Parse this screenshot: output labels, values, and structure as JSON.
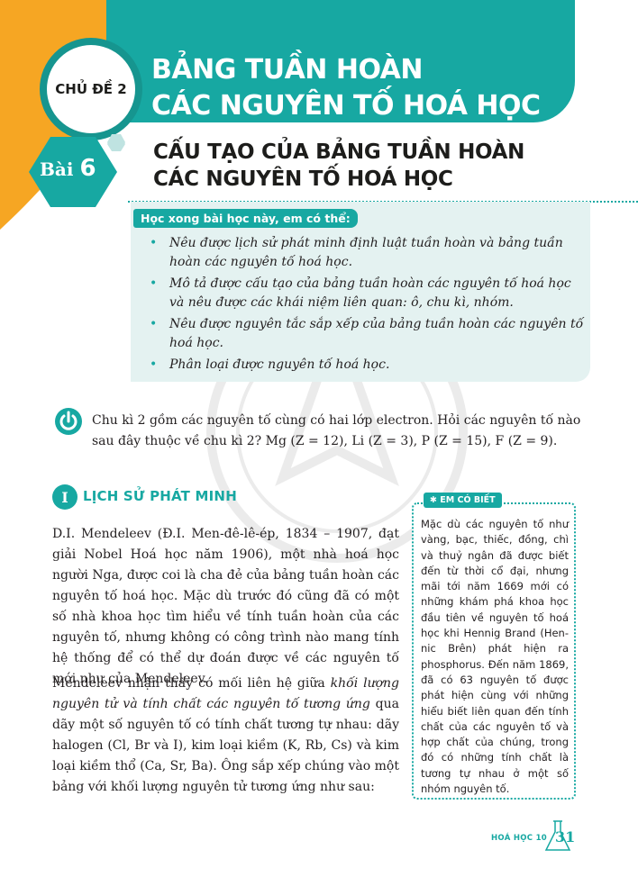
{
  "header": {
    "chapter_label": "CHỦ ĐỀ 2",
    "chapter_title_line1": "BẢNG TUẦN HOÀN",
    "chapter_title_line2": "CÁC NGUYÊN TỐ HOÁ HỌC",
    "lesson_word": "Bài",
    "lesson_number": "6",
    "lesson_title_line1": "CẤU TẠO CỦA BẢNG TUẦN HOÀN",
    "lesson_title_line2": "CÁC NGUYÊN TỐ HOÁ HỌC"
  },
  "objectives": {
    "heading": "Học xong bài học này, em có thể:",
    "items": [
      "Nêu được lịch sử phát minh định luật tuần hoàn và bảng tuần hoàn các nguyên tố hoá học.",
      "Mô tả được cấu tạo của bảng tuần hoàn các nguyên tố hoá học và nêu được các khái niệm liên quan: ô, chu kì, nhóm.",
      "Nêu được nguyên tắc sắp xếp của bảng tuần hoàn các nguyên tố hoá học.",
      "Phân loại được nguyên tố hoá học."
    ]
  },
  "question": {
    "text": "Chu kì 2 gồm các nguyên tố cùng có hai lớp electron. Hỏi các nguyên tố nào sau đây thuộc về chu kì 2? Mg (Z = 12), Li (Z = 3), P (Z = 15), F (Z = 9)."
  },
  "section": {
    "number": "I",
    "title": "LỊCH SỬ PHÁT MINH",
    "paragraph1": "D.I. Mendeleev (Đ.I. Men-đê-lê-ép, 1834 – 1907, đạt giải Nobel Hoá học năm 1906), một nhà hoá học người Nga, được coi là cha đẻ của bảng tuần hoàn các nguyên tố hoá học. Mặc dù trước đó cũng đã có một số nhà khoa học tìm hiểu về tính tuần hoàn của các nguyên tố, nhưng không có công trình nào mang tính hệ thống để có thể dự đoán được về các nguyên tố mới như của Mendeleev.",
    "paragraph2_start": "Mendeleev nhận thấy có mối liên hệ giữa ",
    "paragraph2_emphasis": "khối lượng nguyên tử và tính chất các nguyên tố tương ứng",
    "paragraph2_end": " qua dãy một số nguyên tố có tính chất tương tự nhau: dãy halogen (Cl, Br và I), kim loại kiềm (K, Rb, Cs) và kim loại kiềm thổ (Ca, Sr, Ba). Ông sắp xếp chúng vào một bảng với khối lượng nguyên tử tương ứng như sau:"
  },
  "sidebox": {
    "heading": "EM CÓ BIẾT",
    "text": "Mặc dù các nguyên tố như vàng, bạc, thiếc, đồng, chì và thuỷ ngân đã được biết đến từ thời cổ đại, nhưng mãi tới năm 1669 mới có những khám phá khoa học đầu tiên về nguyên tố hoá học khi Hennig Brand (Hen-nic Brên) phát hiện ra phosphorus. Đến năm 1869, đã có 63 nguyên tố được phát hiện cùng với những hiểu biết liên quan đến tính chất của các nguyên tố và hợp chất của chúng, trong đó có những tính chất là tương tự nhau ở một số nhóm nguyên tố."
  },
  "footer": {
    "book": "HOÁ HỌC 10",
    "page": "31"
  },
  "colors": {
    "teal": "#17a8a2",
    "orange": "#f6a623",
    "light_teal_bg": "#e4f2f1"
  }
}
